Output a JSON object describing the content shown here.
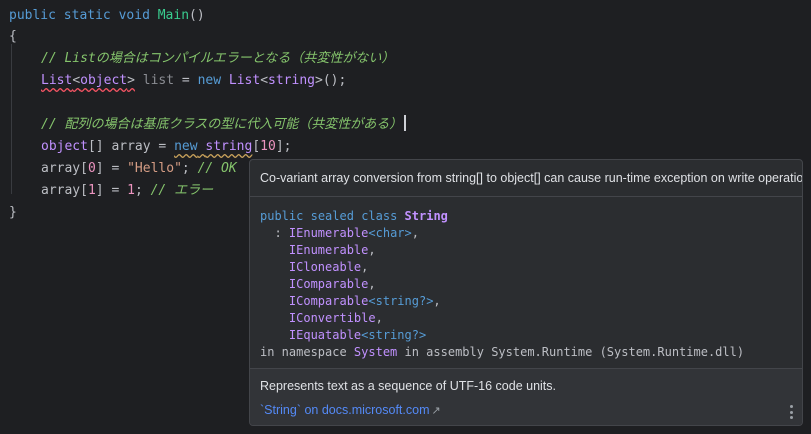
{
  "code": {
    "l1": {
      "kw1": "public",
      "kw2": "static",
      "kw3": "void",
      "fn": "Main",
      "rest": "()"
    },
    "l2": "{",
    "l3": "// Listの場合はコンパイルエラーとなる（共変性がない）",
    "l4": {
      "t1": "List",
      "lt1": "<",
      "t2": "object",
      "gt1": ">",
      "var": " list",
      "eq": " = ",
      "kw": "new",
      "sp": " ",
      "t3": "List",
      "lt2": "<",
      "t4": "string",
      "gt2": ">",
      "end": "();"
    },
    "l6": "// 配列の場合は基底クラスの型に代入可能（共変性がある）",
    "l7": {
      "t1": "object",
      "a1": "[] array = ",
      "kw": "new",
      "sp": " ",
      "t2": "string",
      "a2": "[",
      "n": "10",
      "a3": "];"
    },
    "l8": {
      "a1": "array[",
      "n": "0",
      "a2": "] = ",
      "s": "\"Hello\"",
      "a3": "; ",
      "c": "// OK"
    },
    "l9": {
      "a1": "array[",
      "n1": "1",
      "a2": "] = ",
      "n2": "1",
      "a3": "; ",
      "c": "// エラー"
    },
    "l10": "}"
  },
  "popup": {
    "warning": "Co-variant array conversion from string[] to object[] can cause run-time exception on write operation",
    "decl": {
      "kw1": "public",
      "kw2": "sealed",
      "kw3": "class",
      "name": "String",
      "colon": "  : ",
      "ifaces": [
        {
          "name": "IEnumerable",
          "generic": "<char>",
          "tail": ","
        },
        {
          "name": "IEnumerable",
          "generic": "",
          "tail": ","
        },
        {
          "name": "ICloneable",
          "generic": "",
          "tail": ","
        },
        {
          "name": "IComparable",
          "generic": "",
          "tail": ","
        },
        {
          "name": "IComparable",
          "generic": "<string?>",
          "tail": ","
        },
        {
          "name": "IConvertible",
          "generic": "",
          "tail": ","
        },
        {
          "name": "IEquatable",
          "generic": "<string?>",
          "tail": ""
        }
      ],
      "ns_prefix": "in namespace ",
      "ns": "System",
      "ns_suffix": " in assembly System.Runtime (System.Runtime.dll)"
    },
    "description": "Represents text as a sequence of UTF-16 code units.",
    "link": "`String` on docs.microsoft.com",
    "link_icon": "external-link-icon",
    "menu_icon": "more-vertical-icon"
  },
  "colors": {
    "background": "#1e1f22",
    "keyword": "#569cd6",
    "type": "#c191ff",
    "method": "#39cc8f",
    "string": "#d69d85",
    "comment": "#85c46c",
    "link": "#548af7"
  }
}
